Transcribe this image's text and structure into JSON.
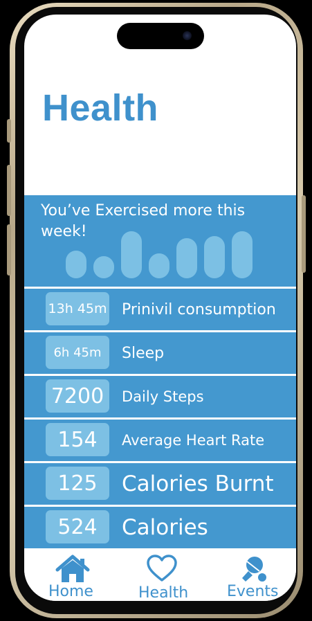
{
  "header": {
    "title": "Health"
  },
  "summary": {
    "message": "You’ve Exercised more this week!",
    "weekly_activity_levels": [
      0.55,
      0.45,
      0.95,
      0.5,
      0.8,
      0.85,
      0.95
    ]
  },
  "metrics": [
    {
      "value": "13h 45m",
      "label": "Prinivil consumption"
    },
    {
      "value": "6h 45m",
      "label": "Sleep"
    },
    {
      "value": "7200",
      "label": "Daily Steps"
    },
    {
      "value": "154",
      "label": "Average Heart Rate"
    },
    {
      "value": "125",
      "label": "Calories Burnt"
    },
    {
      "value": "524",
      "label": "Calories"
    }
  ],
  "tabbar": {
    "items": [
      {
        "label": "Home",
        "icon": "home-icon"
      },
      {
        "label": "Health",
        "icon": "heart-icon"
      },
      {
        "label": "Events",
        "icon": "ping-pong-icon"
      }
    ]
  },
  "colors": {
    "accent": "#3f91cc",
    "panel": "#4498cf",
    "badge": "#7dc0e4"
  }
}
